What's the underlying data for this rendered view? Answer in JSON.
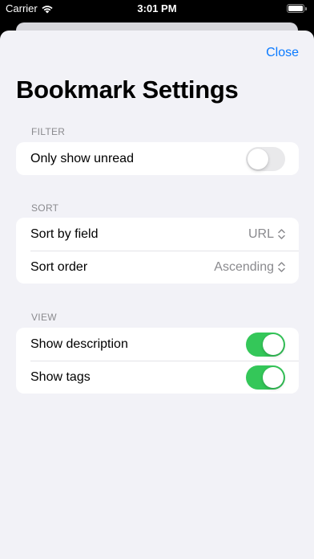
{
  "status_bar": {
    "carrier": "Carrier",
    "time": "3:01 PM",
    "icons": [
      "wifi-icon",
      "battery-icon"
    ]
  },
  "toolbar": {
    "close_label": "Close"
  },
  "title": "Bookmark Settings",
  "sections": {
    "filter": {
      "header": "FILTER",
      "rows": {
        "unread": {
          "label": "Only show unread",
          "toggle_on": false
        }
      }
    },
    "sort": {
      "header": "SORT",
      "rows": {
        "field": {
          "label": "Sort by field",
          "value": "URL"
        },
        "order": {
          "label": "Sort order",
          "value": "Ascending"
        }
      }
    },
    "view": {
      "header": "VIEW",
      "rows": {
        "description": {
          "label": "Show description",
          "toggle_on": true
        },
        "tags": {
          "label": "Show tags",
          "toggle_on": true
        }
      }
    }
  },
  "colors": {
    "accent": "#0a7aff",
    "toggle_on": "#34c759",
    "toggle_off": "#e9e9eb",
    "background": "#f2f2f7",
    "secondary_text": "#8a8a8e"
  }
}
